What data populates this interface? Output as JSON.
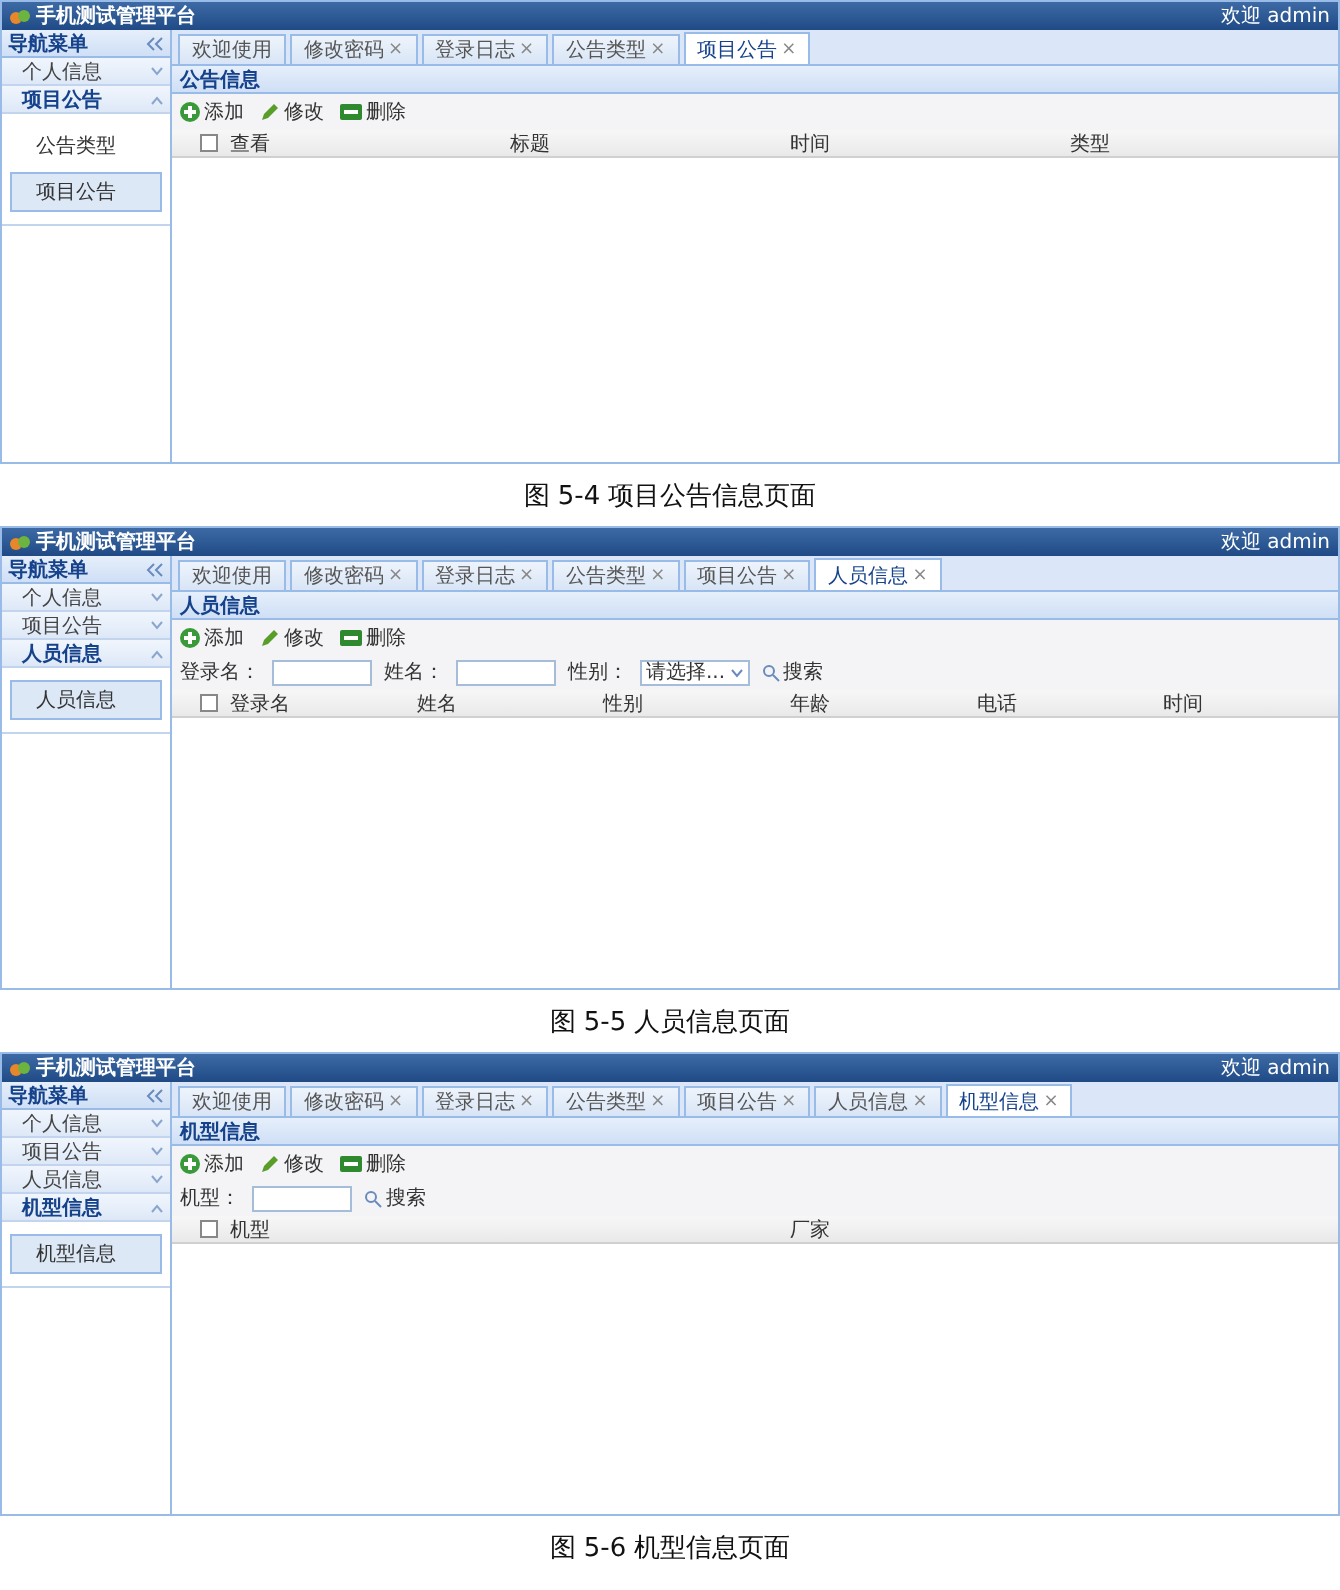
{
  "figures": [
    {
      "screen": {
        "app_title": "手机测试管理平台",
        "user_text": "欢迎 admin",
        "menu_title": "导航菜单",
        "groups": [
          {
            "label": "个人信息",
            "expanded": false
          },
          {
            "label": "项目公告",
            "expanded": true,
            "children": [
              {
                "label": "公告类型",
                "selected": false
              },
              {
                "label": "项目公告",
                "selected": true
              }
            ]
          }
        ],
        "tabs": [
          {
            "label": "欢迎使用",
            "selected": false
          },
          {
            "label": "修改密码",
            "close": "×",
            "selected": false
          },
          {
            "label": "登录日志",
            "close": "×",
            "selected": false
          },
          {
            "label": "公告类型",
            "close": "×",
            "selected": false
          },
          {
            "label": "项目公告",
            "close": "×",
            "selected": true
          }
        ],
        "header_checked": false,
        "panel_title": "公告信息",
        "toolbar": [
          {
            "kind": "add",
            "label": "添加"
          },
          {
            "kind": "edit",
            "label": "修改"
          },
          {
            "kind": "delete",
            "label": "删除"
          }
        ],
        "columns": [
          "查看",
          "标题",
          "时间",
          "类型"
        ]
      },
      "caption": "图 5-4 项目公告信息页面"
    },
    {
      "screen": {
        "app_title": "手机测试管理平台",
        "user_text": "欢迎 admin",
        "menu_title": "导航菜单",
        "groups": [
          {
            "label": "个人信息",
            "expanded": false
          },
          {
            "label": "项目公告",
            "expanded": false
          },
          {
            "label": "人员信息",
            "expanded": true,
            "children": [
              {
                "label": "人员信息",
                "selected": true
              }
            ]
          }
        ],
        "tabs": [
          {
            "label": "欢迎使用",
            "selected": false
          },
          {
            "label": "修改密码",
            "close": "×",
            "selected": false
          },
          {
            "label": "登录日志",
            "close": "×",
            "selected": false
          },
          {
            "label": "公告类型",
            "close": "×",
            "selected": false
          },
          {
            "label": "项目公告",
            "close": "×",
            "selected": false
          },
          {
            "label": "人员信息",
            "close": "×",
            "selected": true
          }
        ],
        "header_checked": false,
        "panel_title": "人员信息",
        "toolbar": [
          {
            "kind": "add",
            "label": "添加"
          },
          {
            "kind": "edit",
            "label": "修改"
          },
          {
            "kind": "delete",
            "label": "删除"
          }
        ],
        "filters": [
          {
            "kind": "text",
            "label": "登录名："
          },
          {
            "kind": "text",
            "label": "姓名："
          },
          {
            "kind": "select",
            "label": "性别：",
            "value": "请选择..."
          },
          {
            "kind": "search",
            "label": "搜索"
          }
        ],
        "columns": [
          "登录名",
          "姓名",
          "性别",
          "年龄",
          "电话",
          "时间"
        ]
      },
      "caption": "图 5-5 人员信息页面"
    },
    {
      "screen": {
        "app_title": "手机测试管理平台",
        "user_text": "欢迎 admin",
        "menu_title": "导航菜单",
        "groups": [
          {
            "label": "个人信息",
            "expanded": false
          },
          {
            "label": "项目公告",
            "expanded": false
          },
          {
            "label": "人员信息",
            "expanded": false
          },
          {
            "label": "机型信息",
            "expanded": true,
            "children": [
              {
                "label": "机型信息",
                "selected": true
              }
            ]
          }
        ],
        "tabs": [
          {
            "label": "欢迎使用",
            "selected": false
          },
          {
            "label": "修改密码",
            "close": "×",
            "selected": false
          },
          {
            "label": "登录日志",
            "close": "×",
            "selected": false
          },
          {
            "label": "公告类型",
            "close": "×",
            "selected": false
          },
          {
            "label": "项目公告",
            "close": "×",
            "selected": false
          },
          {
            "label": "人员信息",
            "close": "×",
            "selected": false
          },
          {
            "label": "机型信息",
            "close": "×",
            "selected": true
          }
        ],
        "header_checked": false,
        "panel_title": "机型信息",
        "toolbar": [
          {
            "kind": "add",
            "label": "添加"
          },
          {
            "kind": "edit",
            "label": "修改"
          },
          {
            "kind": "delete",
            "label": "删除"
          }
        ],
        "filters": [
          {
            "kind": "text",
            "label": "机型："
          },
          {
            "kind": "search",
            "label": "搜索"
          }
        ],
        "columns": [
          "机型",
          "厂家"
        ]
      },
      "caption": "图 5-6 机型信息页面"
    }
  ]
}
